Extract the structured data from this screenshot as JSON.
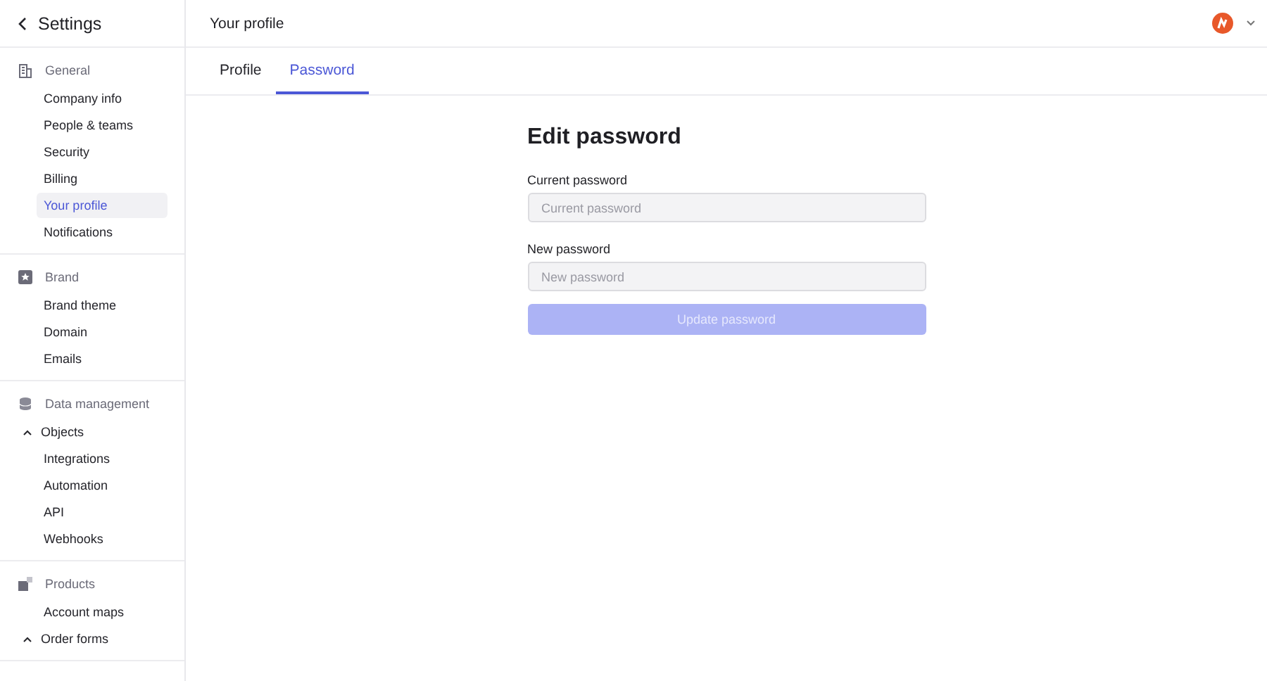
{
  "sidebar": {
    "title": "Settings",
    "sections": [
      {
        "kind": "building",
        "title": "General",
        "items": [
          {
            "kind": "link",
            "label": "Company info",
            "selected": false
          },
          {
            "kind": "link",
            "label": "People & teams",
            "selected": false
          },
          {
            "kind": "link",
            "label": "Security",
            "selected": false
          },
          {
            "kind": "link",
            "label": "Billing",
            "selected": false
          },
          {
            "kind": "link",
            "label": "Your profile",
            "selected": true
          },
          {
            "kind": "link",
            "label": "Notifications",
            "selected": false
          }
        ]
      },
      {
        "kind": "star",
        "title": "Brand",
        "items": [
          {
            "kind": "link",
            "label": "Brand theme",
            "selected": false
          },
          {
            "kind": "link",
            "label": "Domain",
            "selected": false
          },
          {
            "kind": "link",
            "label": "Emails",
            "selected": false
          }
        ]
      },
      {
        "kind": "database",
        "title": "Data management",
        "items": [
          {
            "kind": "group",
            "label": "Objects",
            "expanded": true
          },
          {
            "kind": "link",
            "label": "Integrations",
            "selected": false
          },
          {
            "kind": "link",
            "label": "Automation",
            "selected": false
          },
          {
            "kind": "link",
            "label": "API",
            "selected": false
          },
          {
            "kind": "link",
            "label": "Webhooks",
            "selected": false
          }
        ]
      },
      {
        "kind": "box",
        "title": "Products",
        "items": [
          {
            "kind": "link",
            "label": "Account maps",
            "selected": false
          },
          {
            "kind": "group",
            "label": "Order forms",
            "expanded": true
          }
        ]
      }
    ]
  },
  "header": {
    "title": "Your profile"
  },
  "tabs": [
    {
      "label": "Profile",
      "selected": false
    },
    {
      "label": "Password",
      "selected": true
    }
  ],
  "form": {
    "title": "Edit password",
    "fields": [
      {
        "label": "Current password",
        "placeholder": "Current password"
      },
      {
        "label": "New password",
        "placeholder": "New password"
      }
    ],
    "submit": {
      "label": "Update password",
      "disabled": true
    }
  }
}
